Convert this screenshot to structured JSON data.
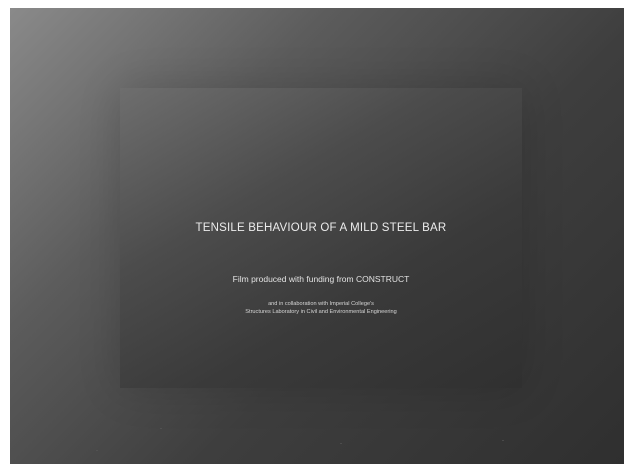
{
  "slide": {
    "title": "TENSILE BEHAVIOUR OF A MILD STEEL BAR",
    "funding": "Film produced with funding from CONSTRUCT",
    "collab_line1": "and in collaboration with Imperial College's",
    "collab_line2": "Structures Laboratory in Civil and Environmental Engineering"
  },
  "colors": {
    "background_light": "#8a8a8a",
    "background_dark": "#2f2f2f",
    "text": "#ececec"
  }
}
